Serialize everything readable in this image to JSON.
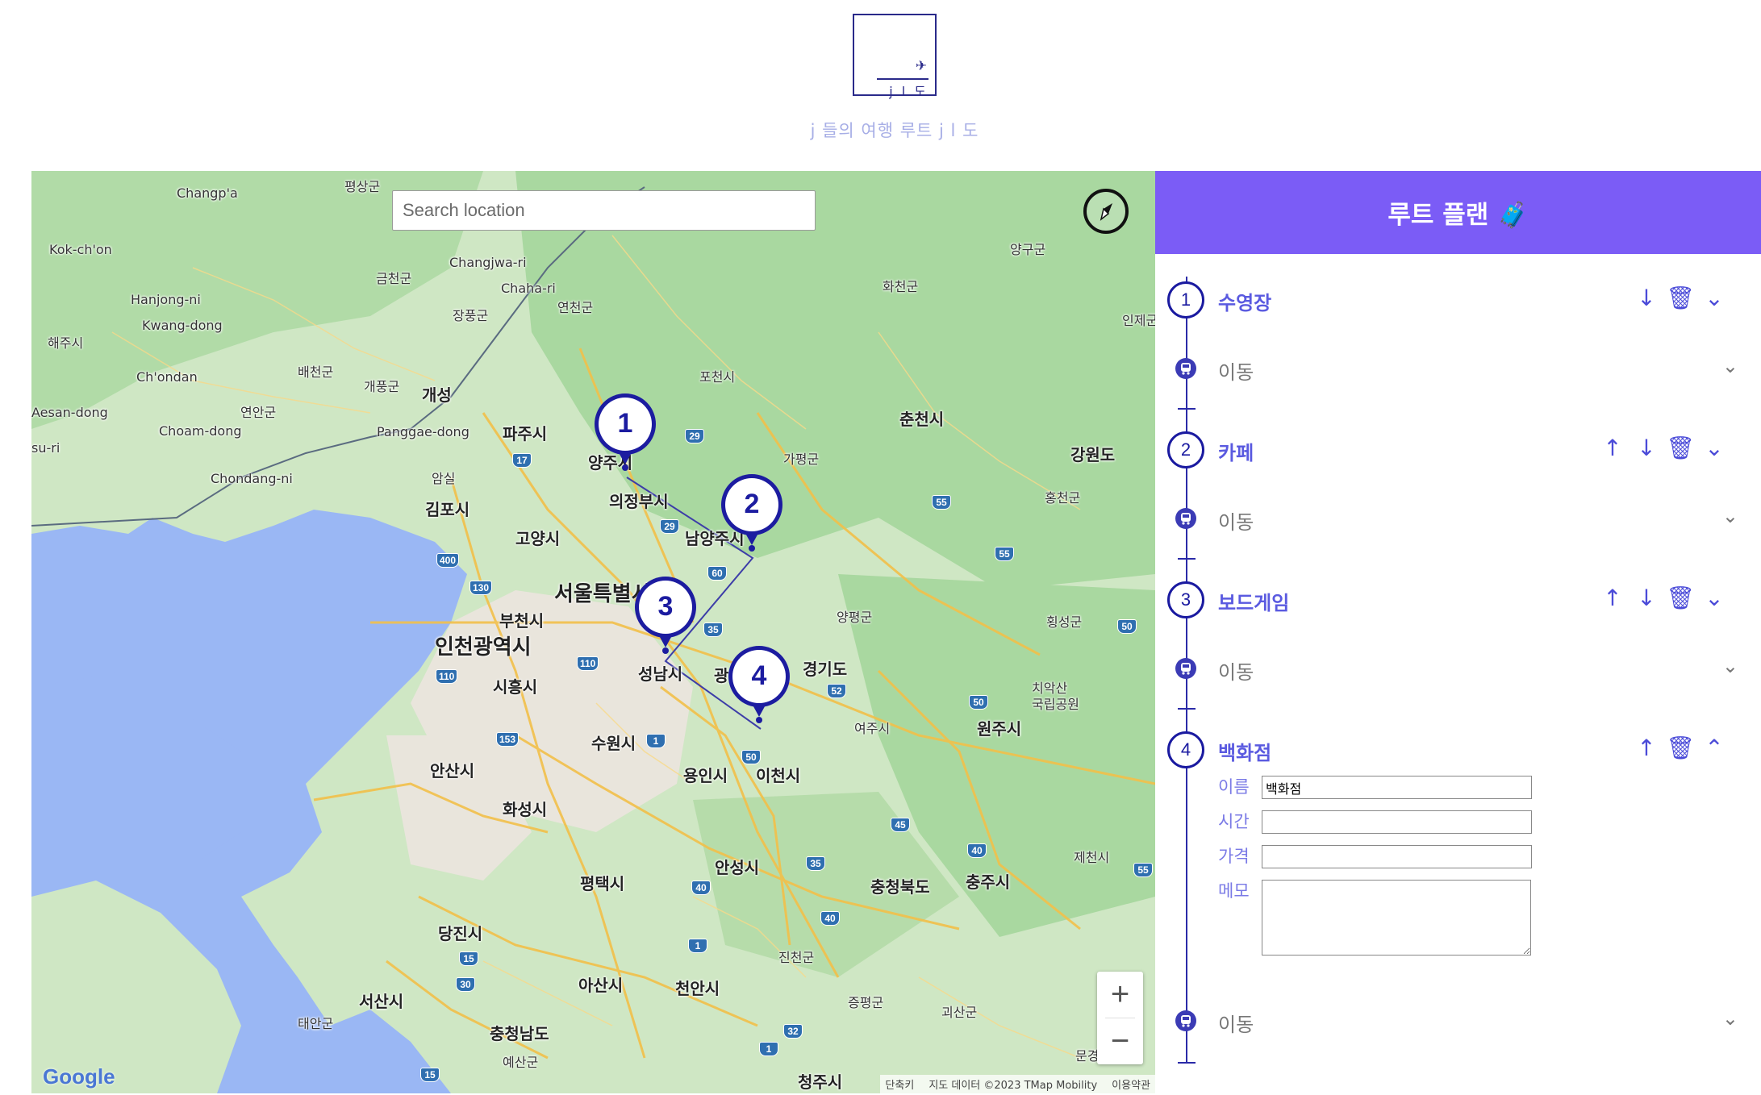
{
  "header": {
    "logo_text": "j l 도",
    "subtitle": "j 들의 여행 루트 j l 도"
  },
  "map": {
    "search_placeholder": "Search location",
    "google_logo": "Google",
    "attribution": [
      "단축키",
      "지도 데이터 ©2023 TMap Mobility",
      "이용약관"
    ],
    "zoom_in": "+",
    "zoom_out": "−",
    "markers": [
      "1",
      "2",
      "3",
      "4"
    ],
    "labels": [
      {
        "t": "평상군",
        "c": "s"
      },
      {
        "t": "Changp'a",
        "c": "s"
      },
      {
        "t": "Kok-ch'on",
        "c": "s"
      },
      {
        "t": "Changjwa-ri",
        "c": "s"
      },
      {
        "t": "Chaha-ri",
        "c": "s"
      },
      {
        "t": "금천군",
        "c": "s"
      },
      {
        "t": "Hanjong-ni",
        "c": "s"
      },
      {
        "t": "Kwang-dong",
        "c": "s"
      },
      {
        "t": "해주시",
        "c": "s"
      },
      {
        "t": "장풍군",
        "c": "s"
      },
      {
        "t": "연천군",
        "c": "s"
      },
      {
        "t": "양구군",
        "c": "s"
      },
      {
        "t": "화천군",
        "c": "s"
      },
      {
        "t": "인제군",
        "c": "s"
      },
      {
        "t": "배천군",
        "c": "s"
      },
      {
        "t": "Ch'ondan",
        "c": "s"
      },
      {
        "t": "개풍군",
        "c": "s"
      },
      {
        "t": "개성",
        "c": "m"
      },
      {
        "t": "포천시",
        "c": "s"
      },
      {
        "t": "Aesan-dong",
        "c": "s"
      },
      {
        "t": "연안군",
        "c": "s"
      },
      {
        "t": "Choam-dong",
        "c": "s"
      },
      {
        "t": "Panggae-dong",
        "c": "s"
      },
      {
        "t": "파주시",
        "c": "m"
      },
      {
        "t": "춘천시",
        "c": "m"
      },
      {
        "t": "su-ri",
        "c": "s"
      },
      {
        "t": "양주시",
        "c": "m"
      },
      {
        "t": "가평군",
        "c": "s"
      },
      {
        "t": "강원도",
        "c": "m"
      },
      {
        "t": "암실",
        "c": "s"
      },
      {
        "t": "Chondang-ni",
        "c": "s"
      },
      {
        "t": "홍천군",
        "c": "s"
      },
      {
        "t": "의정부시",
        "c": "m"
      },
      {
        "t": "김포시",
        "c": "m"
      },
      {
        "t": "고양시",
        "c": "m"
      },
      {
        "t": "남양주시",
        "c": "m"
      },
      {
        "t": "서울특별시",
        "c": "l"
      },
      {
        "t": "부천시",
        "c": "m"
      },
      {
        "t": "양평군",
        "c": "s"
      },
      {
        "t": "횡성군",
        "c": "s"
      },
      {
        "t": "인천광역시",
        "c": "l"
      },
      {
        "t": "성남시",
        "c": "m"
      },
      {
        "t": "경기도",
        "c": "m"
      },
      {
        "t": "시흥시",
        "c": "m"
      },
      {
        "t": "치악산",
        "c": "s"
      },
      {
        "t": "국립공원",
        "c": "s"
      },
      {
        "t": "여주시",
        "c": "s"
      },
      {
        "t": "원주시",
        "c": "m"
      },
      {
        "t": "수원시",
        "c": "m"
      },
      {
        "t": "용인시",
        "c": "m"
      },
      {
        "t": "안산시",
        "c": "m"
      },
      {
        "t": "이천시",
        "c": "m"
      },
      {
        "t": "화성시",
        "c": "m"
      },
      {
        "t": "제천시",
        "c": "s"
      },
      {
        "t": "안성시",
        "c": "m"
      },
      {
        "t": "평택시",
        "c": "m"
      },
      {
        "t": "충청북도",
        "c": "m"
      },
      {
        "t": "충주시",
        "c": "m"
      },
      {
        "t": "당진시",
        "c": "m"
      },
      {
        "t": "진천군",
        "c": "s"
      },
      {
        "t": "아산시",
        "c": "m"
      },
      {
        "t": "천안시",
        "c": "m"
      },
      {
        "t": "증평군",
        "c": "s"
      },
      {
        "t": "괴산군",
        "c": "s"
      },
      {
        "t": "서산시",
        "c": "m"
      },
      {
        "t": "태안군",
        "c": "s"
      },
      {
        "t": "충청남도",
        "c": "m"
      },
      {
        "t": "예산군",
        "c": "s"
      },
      {
        "t": "청주시",
        "c": "m"
      },
      {
        "t": "문경",
        "c": "s"
      },
      {
        "t": "광",
        "c": "m"
      }
    ],
    "highway_shields": [
      "17",
      "29",
      "29",
      "60",
      "400",
      "130",
      "35",
      "110",
      "110",
      "52",
      "153",
      "1",
      "50",
      "50",
      "55",
      "55",
      "50",
      "45",
      "40",
      "35",
      "40",
      "40",
      "1",
      "15",
      "30",
      "32",
      "1",
      "15",
      "55"
    ]
  },
  "route": {
    "title": "루트 플랜 🧳",
    "move_label": "이동",
    "stops": [
      {
        "num": "1",
        "name": "수영장"
      },
      {
        "num": "2",
        "name": "카페"
      },
      {
        "num": "3",
        "name": "보드게임"
      },
      {
        "num": "4",
        "name": "백화점"
      }
    ],
    "form": {
      "name_label": "이름",
      "name_value": "백화점",
      "time_label": "시간",
      "time_value": "",
      "price_label": "가격",
      "price_value": "",
      "memo_label": "메모",
      "memo_value": ""
    },
    "accent_color": "#7b5cf6",
    "line_color": "#2a2aa8"
  }
}
